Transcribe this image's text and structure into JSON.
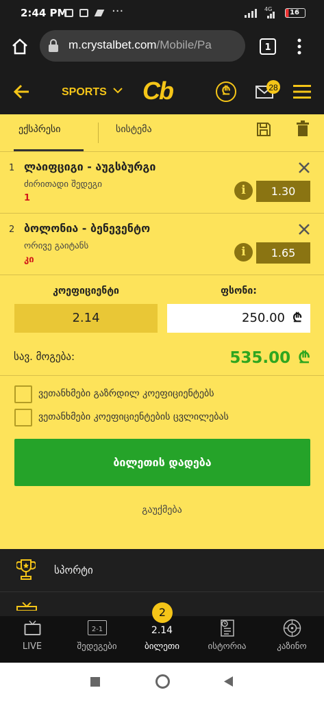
{
  "status": {
    "time": "2:44 PM",
    "dots": "···",
    "network": "4G",
    "battery": "16"
  },
  "browser": {
    "url_host": "m.crystalbet.com",
    "url_path": "/Mobile/Pa",
    "tab_count": "1"
  },
  "app": {
    "sports_label": "SPORTS",
    "logo": "Cb",
    "mail_badge": "28",
    "brand_color": "#f5c518"
  },
  "slip": {
    "tabs": [
      {
        "label": "ექსპრესი"
      },
      {
        "label": "სისტემა"
      }
    ],
    "bets": [
      {
        "index": "1",
        "match": "ლაიფციგი - აუგსბურგი",
        "market": "ძირითადი შედეგი",
        "selection": "1",
        "odds": "1.30"
      },
      {
        "index": "2",
        "match": "ბოლონია - ბენევენტო",
        "market": "ორივე გაიტანს",
        "selection": "კი",
        "odds": "1.65"
      }
    ],
    "coef_label": "კოეფიციენტი",
    "stake_label": "ფსონი:",
    "coef_value": "2.14",
    "stake_value": "250.00",
    "currency": "₾",
    "total_win_label": "სავ. მოგება:",
    "total_win_value": "535.00",
    "checkboxes": [
      {
        "label": "ვეთანხმები გაზრდილ კოეფიციენტებს"
      },
      {
        "label": "ვეთანხმები კოეფიციენტების ცვლილებას"
      }
    ],
    "place_bet_label": "ბილეთის დადება",
    "cancel_label": "გაუქმება"
  },
  "menu": {
    "sport_label": "სპორტი"
  },
  "bottom_nav": {
    "live_label": "LIVE",
    "results_icon_text": "2-1",
    "results_label": "შედეგები",
    "ticket_count": "2",
    "ticket_odds": "2.14",
    "ticket_label": "ბილეთი",
    "history_label": "ისტორია",
    "casino_label": "კაზინო"
  }
}
